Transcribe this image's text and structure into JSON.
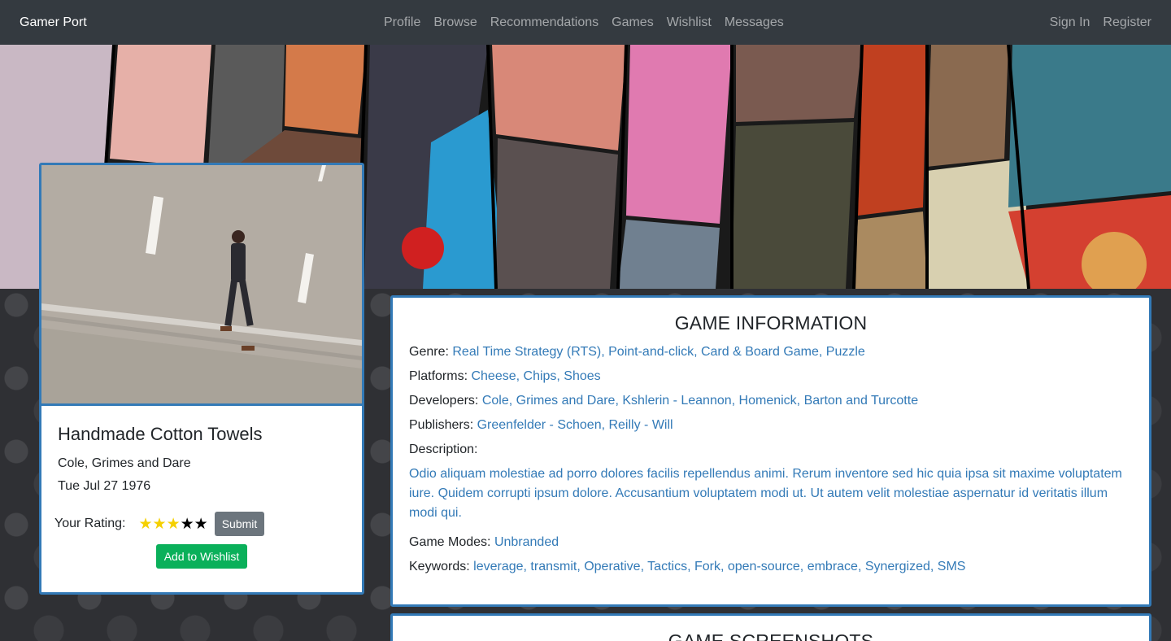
{
  "navbar": {
    "brand": "Gamer Port",
    "links": [
      "Profile",
      "Browse",
      "Recommendations",
      "Games",
      "Wishlist",
      "Messages"
    ],
    "auth": [
      "Sign In",
      "Register"
    ]
  },
  "game": {
    "title": "Handmade Cotton Towels",
    "developer": "Cole, Grimes and Dare",
    "release_date": "Tue Jul 27 1976",
    "rating_label": "Your Rating:",
    "rating": 3,
    "rating_max": 5,
    "submit_label": "Submit",
    "wishlist_label": "Add to Wishlist"
  },
  "info": {
    "heading": "GAME INFORMATION",
    "genre_label": "Genre:",
    "genre": "Real Time Strategy (RTS), Point-and-click, Card & Board Game, Puzzle",
    "platforms_label": "Platforms:",
    "platforms": "Cheese, Chips, Shoes",
    "developers_label": "Developers:",
    "developers": "Cole, Grimes and Dare, Kshlerin - Leannon, Homenick, Barton and Turcotte",
    "publishers_label": "Publishers:",
    "publishers": "Greenfelder - Schoen, Reilly - Will",
    "description_label": "Description:",
    "description": "Odio aliquam molestiae ad porro dolores facilis repellendus animi. Rerum inventore sed hic quia ipsa sit maxime voluptatem iure. Quidem corrupti ipsum dolore. Accusantium voluptatem modi ut. Ut autem velit molestiae aspernatur id veritatis illum modi qui.",
    "modes_label": "Game Modes:",
    "modes": "Unbranded",
    "keywords_label": "Keywords:",
    "keywords": "leverage, transmit, Operative, Tactics, Fork, open-source, embrace, Synergized, SMS"
  },
  "screenshots": {
    "heading": "GAME SCREENSHOTS"
  },
  "colors": {
    "navbar": "#343a40",
    "accent": "#337ab7",
    "wishlist": "#0ab05a",
    "submit": "#6c757d",
    "star_on": "#f5d000"
  }
}
